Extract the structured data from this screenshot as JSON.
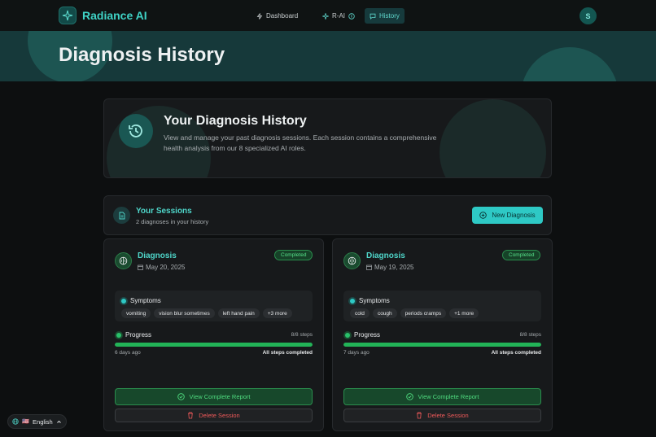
{
  "app": {
    "name": "Radiance AI"
  },
  "nav": {
    "dashboard": "Dashboard",
    "rai": "R-AI",
    "history": "History",
    "avatar_initial": "S"
  },
  "hero": {
    "title": "Diagnosis History"
  },
  "intro": {
    "title": "Your Diagnosis History",
    "description": "View and manage your past diagnosis sessions. Each session contains a comprehensive health analysis from our 8 specialized AI roles."
  },
  "sessions": {
    "title": "Your Sessions",
    "subtitle": "2 diagnoses in your history",
    "new_button": "New Diagnosis"
  },
  "cards": [
    {
      "title": "Diagnosis",
      "date": "May 20, 2025",
      "status": "Completed",
      "symptoms_label": "Symptoms",
      "symptoms": [
        "vomiting",
        "vision blur sometimes",
        "left hand pain",
        "+3 more"
      ],
      "progress_label": "Progress",
      "steps": "8/8 steps",
      "progress": 1.0,
      "ago": "6 days ago",
      "steps_status": "All steps completed",
      "view_label": "View Complete Report",
      "delete_label": "Delete Session"
    },
    {
      "title": "Diagnosis",
      "date": "May 19, 2025",
      "status": "Completed",
      "symptoms_label": "Symptoms",
      "symptoms": [
        "cold",
        "cough",
        "periods cramps",
        "+1 more"
      ],
      "progress_label": "Progress",
      "steps": "8/8 steps",
      "progress": 1.0,
      "ago": "7 days ago",
      "steps_status": "All steps completed",
      "view_label": "View Complete Report",
      "delete_label": "Delete Session"
    }
  ],
  "language": {
    "flag": "🇺🇸",
    "label": "English"
  },
  "colors": {
    "accent": "#2ec9c5",
    "success": "#22b357",
    "danger": "#ef5a5a"
  }
}
